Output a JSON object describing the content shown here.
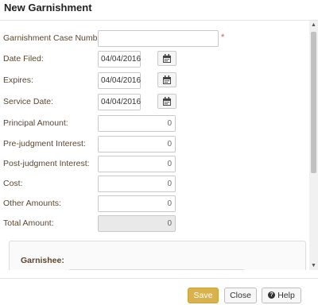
{
  "dialog": {
    "title": "New Garnishment"
  },
  "fields": {
    "case_number": {
      "label": "Garnishment Case Number:",
      "value": "",
      "required_marker": "*"
    },
    "date_filed": {
      "label": "Date Filed:",
      "value": "04/04/2016"
    },
    "expires": {
      "label": "Expires:",
      "value": "04/04/2016"
    },
    "service_date": {
      "label": "Service Date:",
      "value": "04/04/2016"
    },
    "principal_amount": {
      "label": "Principal Amount:",
      "value": "0"
    },
    "prejudgment_interest": {
      "label": "Pre-judgment Interest:",
      "value": "0"
    },
    "postjudgment_interest": {
      "label": "Post-judgment Interest:",
      "value": "0"
    },
    "cost": {
      "label": "Cost:",
      "value": "0"
    },
    "other_amounts": {
      "label": "Other Amounts:",
      "value": "0"
    },
    "total_amount": {
      "label": "Total Amount:",
      "value": "0"
    }
  },
  "garnishee": {
    "label": "Garnishee:"
  },
  "icons": {
    "calendar": "calendar-icon",
    "help": "question-circle-icon",
    "scroll_up": "scroll-up-arrow",
    "scroll_down": "scroll-down-arrow"
  },
  "footer": {
    "save_label": "Save",
    "close_label": "Close",
    "help_label": "Help"
  },
  "colors": {
    "label_text": "#5a4632",
    "save_button": "#d9b24c",
    "required_marker": "#d9534f"
  }
}
